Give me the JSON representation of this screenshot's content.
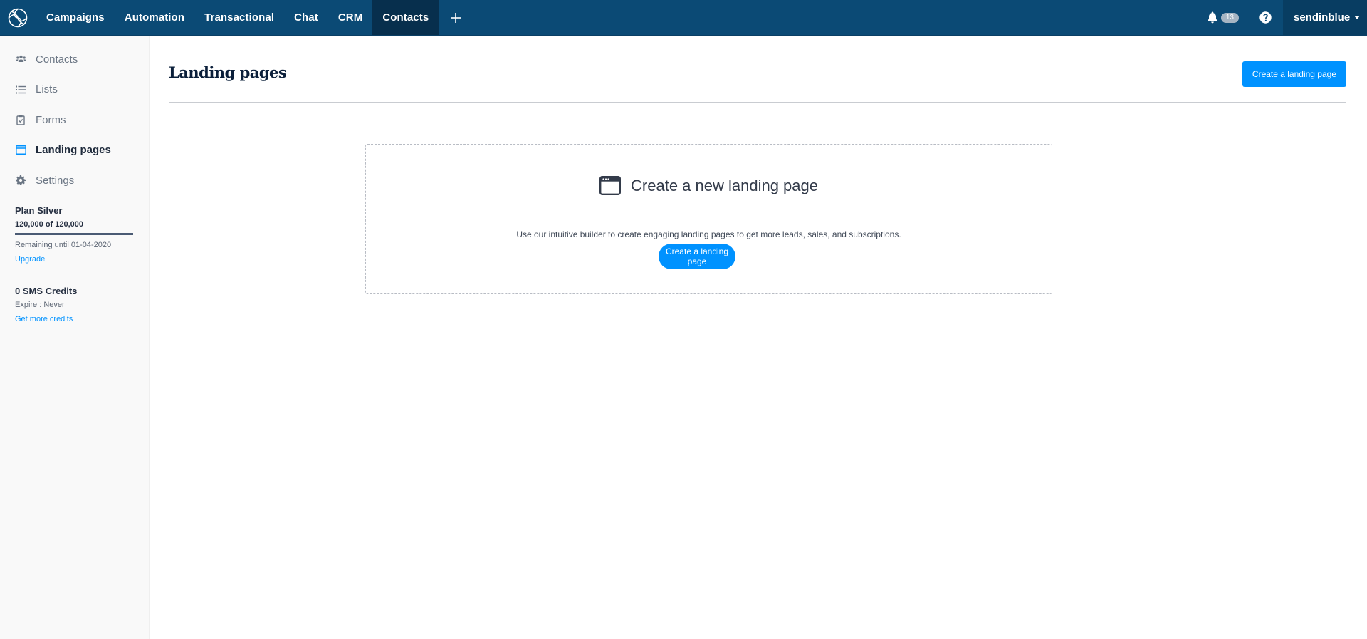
{
  "topnav": {
    "items": [
      {
        "label": "Campaigns"
      },
      {
        "label": "Automation"
      },
      {
        "label": "Transactional"
      },
      {
        "label": "Chat"
      },
      {
        "label": "CRM"
      },
      {
        "label": "Contacts",
        "active": true
      }
    ],
    "notifications_count": "13",
    "account_name": "sendinblue"
  },
  "sidebar": {
    "items": [
      {
        "label": "Contacts",
        "icon": "users-icon"
      },
      {
        "label": "Lists",
        "icon": "list-icon"
      },
      {
        "label": "Forms",
        "icon": "clipboard-check-icon"
      },
      {
        "label": "Landing pages",
        "icon": "browser-window-icon",
        "active": true
      },
      {
        "label": "Settings",
        "icon": "gear-icon"
      }
    ],
    "plan": {
      "title": "Plan Silver",
      "count": "120,000 of 120,000",
      "used_fraction": 1.0,
      "remaining": "Remaining until 01-04-2020",
      "upgrade_label": "Upgrade"
    },
    "sms": {
      "title": "0 SMS Credits",
      "expire": "Expire : Never",
      "more_label": "Get more credits"
    }
  },
  "main": {
    "title": "Landing pages",
    "create_button": "Create a landing page",
    "empty_state": {
      "heading": "Create a new landing page",
      "description": "Use our intuitive builder to create engaging landing pages to get more leads, sales, and subscriptions.",
      "button": "Create a landing page"
    }
  },
  "colors": {
    "topbar": "#0b4a75",
    "topbar_active": "#072f4d",
    "accent": "#0092ff",
    "sidebar_bg": "#f9f9f9"
  }
}
